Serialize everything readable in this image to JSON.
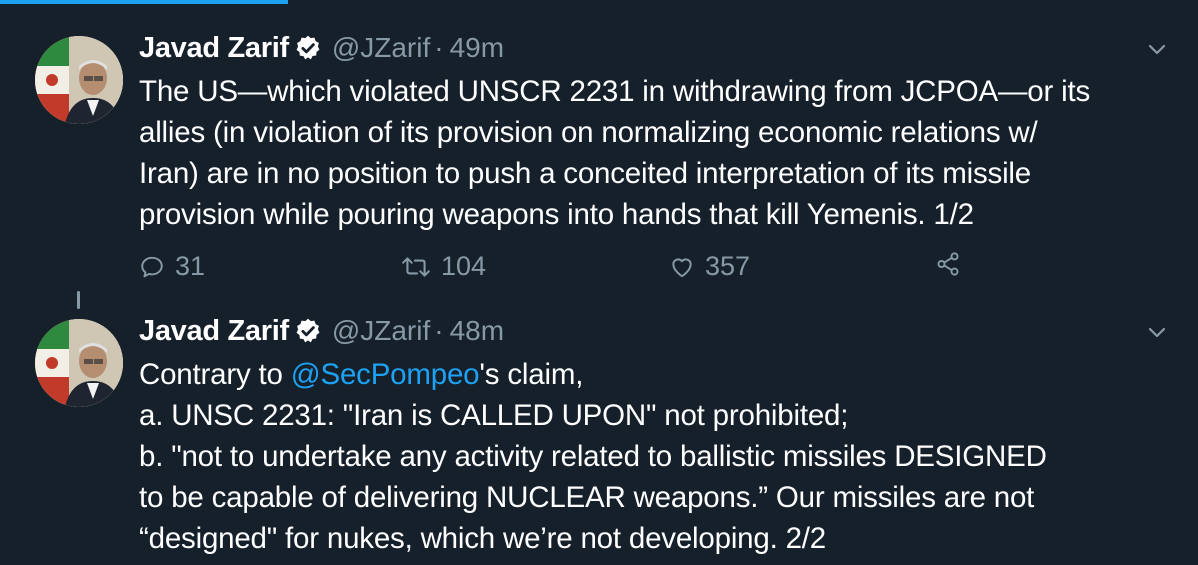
{
  "colors": {
    "background": "#15202b",
    "accent": "#1da1f2",
    "secondary_text": "#8899a6",
    "primary_text": "#ffffff"
  },
  "progress": {
    "fraction": 0.24
  },
  "tweets": [
    {
      "author": {
        "name": "Javad Zarif",
        "handle": "@JZarif",
        "verified": true,
        "avatar_icon": "profile-photo"
      },
      "separator": "·",
      "time": "49m",
      "lines": [
        "The US—which violated UNSCR 2231 in withdrawing from JCPOA—or its",
        "allies (in violation of its provision on normalizing economic relations w/",
        "Iran) are in no position to push a conceited interpretation of its missile",
        "provision while pouring weapons into hands that kill Yemenis. 1/2"
      ],
      "actions": {
        "reply_count": "31",
        "retweet_count": "104",
        "like_count": "357"
      }
    },
    {
      "author": {
        "name": "Javad Zarif",
        "handle": "@JZarif",
        "verified": true,
        "avatar_icon": "profile-photo"
      },
      "separator": "·",
      "time": "48m",
      "line1_prefix": "Contrary to ",
      "mention": "@SecPompeo",
      "line1_suffix": "'s claim,",
      "lines": [
        "a. UNSC 2231:  \"Iran is CALLED UPON\" not prohibited;",
        "b. \"not to undertake any activity related to ballistic missiles DESIGNED",
        "to be capable of delivering NUCLEAR weapons.”  Our missiles are not",
        "“designed\" for nukes, which we’re not developing. 2/2"
      ]
    }
  ]
}
